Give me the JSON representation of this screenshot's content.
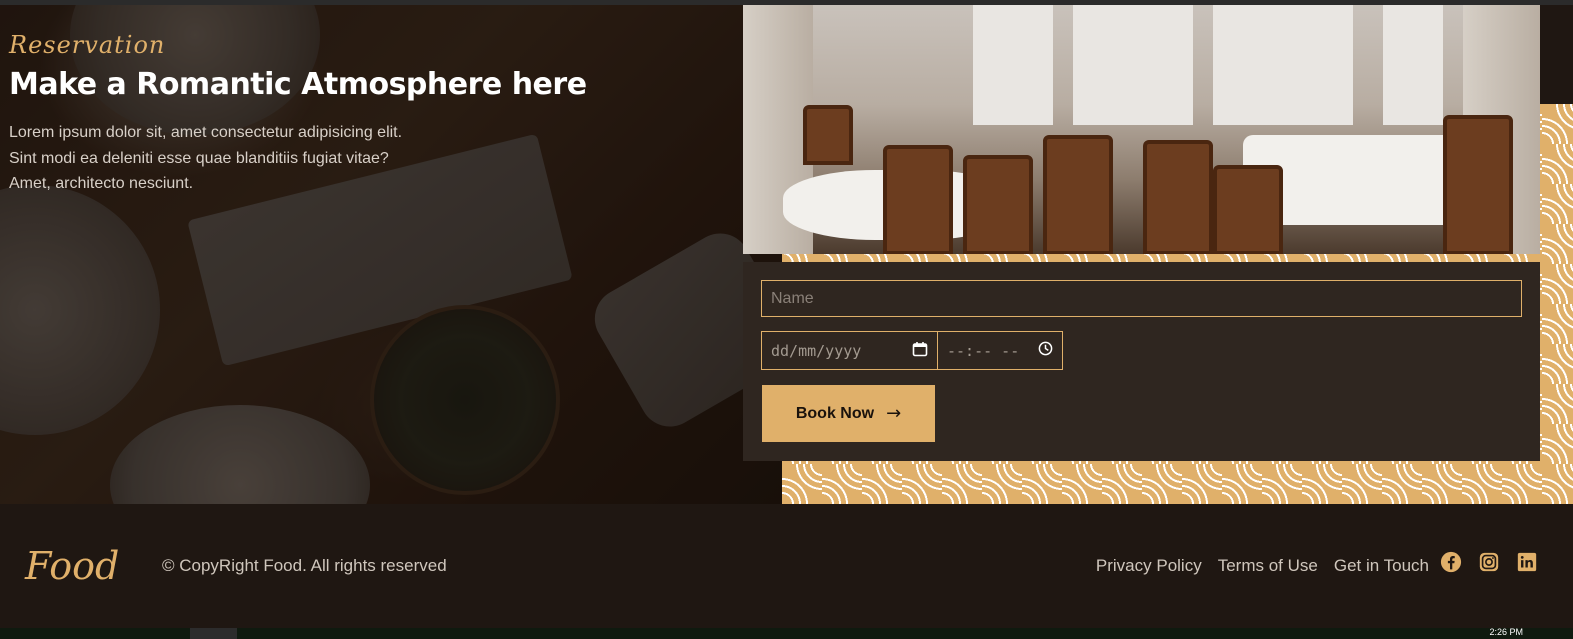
{
  "hero": {
    "kicker": "Reservation",
    "headline": "Make a Romantic Atmosphere here",
    "lede_lines": [
      "Lorem ipsum dolor sit, amet consectetur adipisicing elit.",
      "Sint modi ea deleniti esse quae blanditiis fugiat vitae?",
      "Amet, architecto nesciunt."
    ]
  },
  "form": {
    "name_placeholder": "Name",
    "date_placeholder": "dd/mm/yyyy",
    "time_placeholder": "--:-- --",
    "submit_label": "Book Now"
  },
  "footer": {
    "logo": "Food",
    "copyright": "© CopyRight Food. All rights reserved",
    "links": [
      "Privacy Policy",
      "Terms of Use",
      "Get in Touch"
    ],
    "social_icons": [
      "facebook-icon",
      "instagram-icon",
      "linkedin-icon"
    ]
  },
  "taskbar": {
    "clock": "2:26 PM"
  },
  "colors": {
    "accent": "#e0b06a",
    "footer_bg": "#1f1712",
    "panel_bg": "#2f2620"
  }
}
